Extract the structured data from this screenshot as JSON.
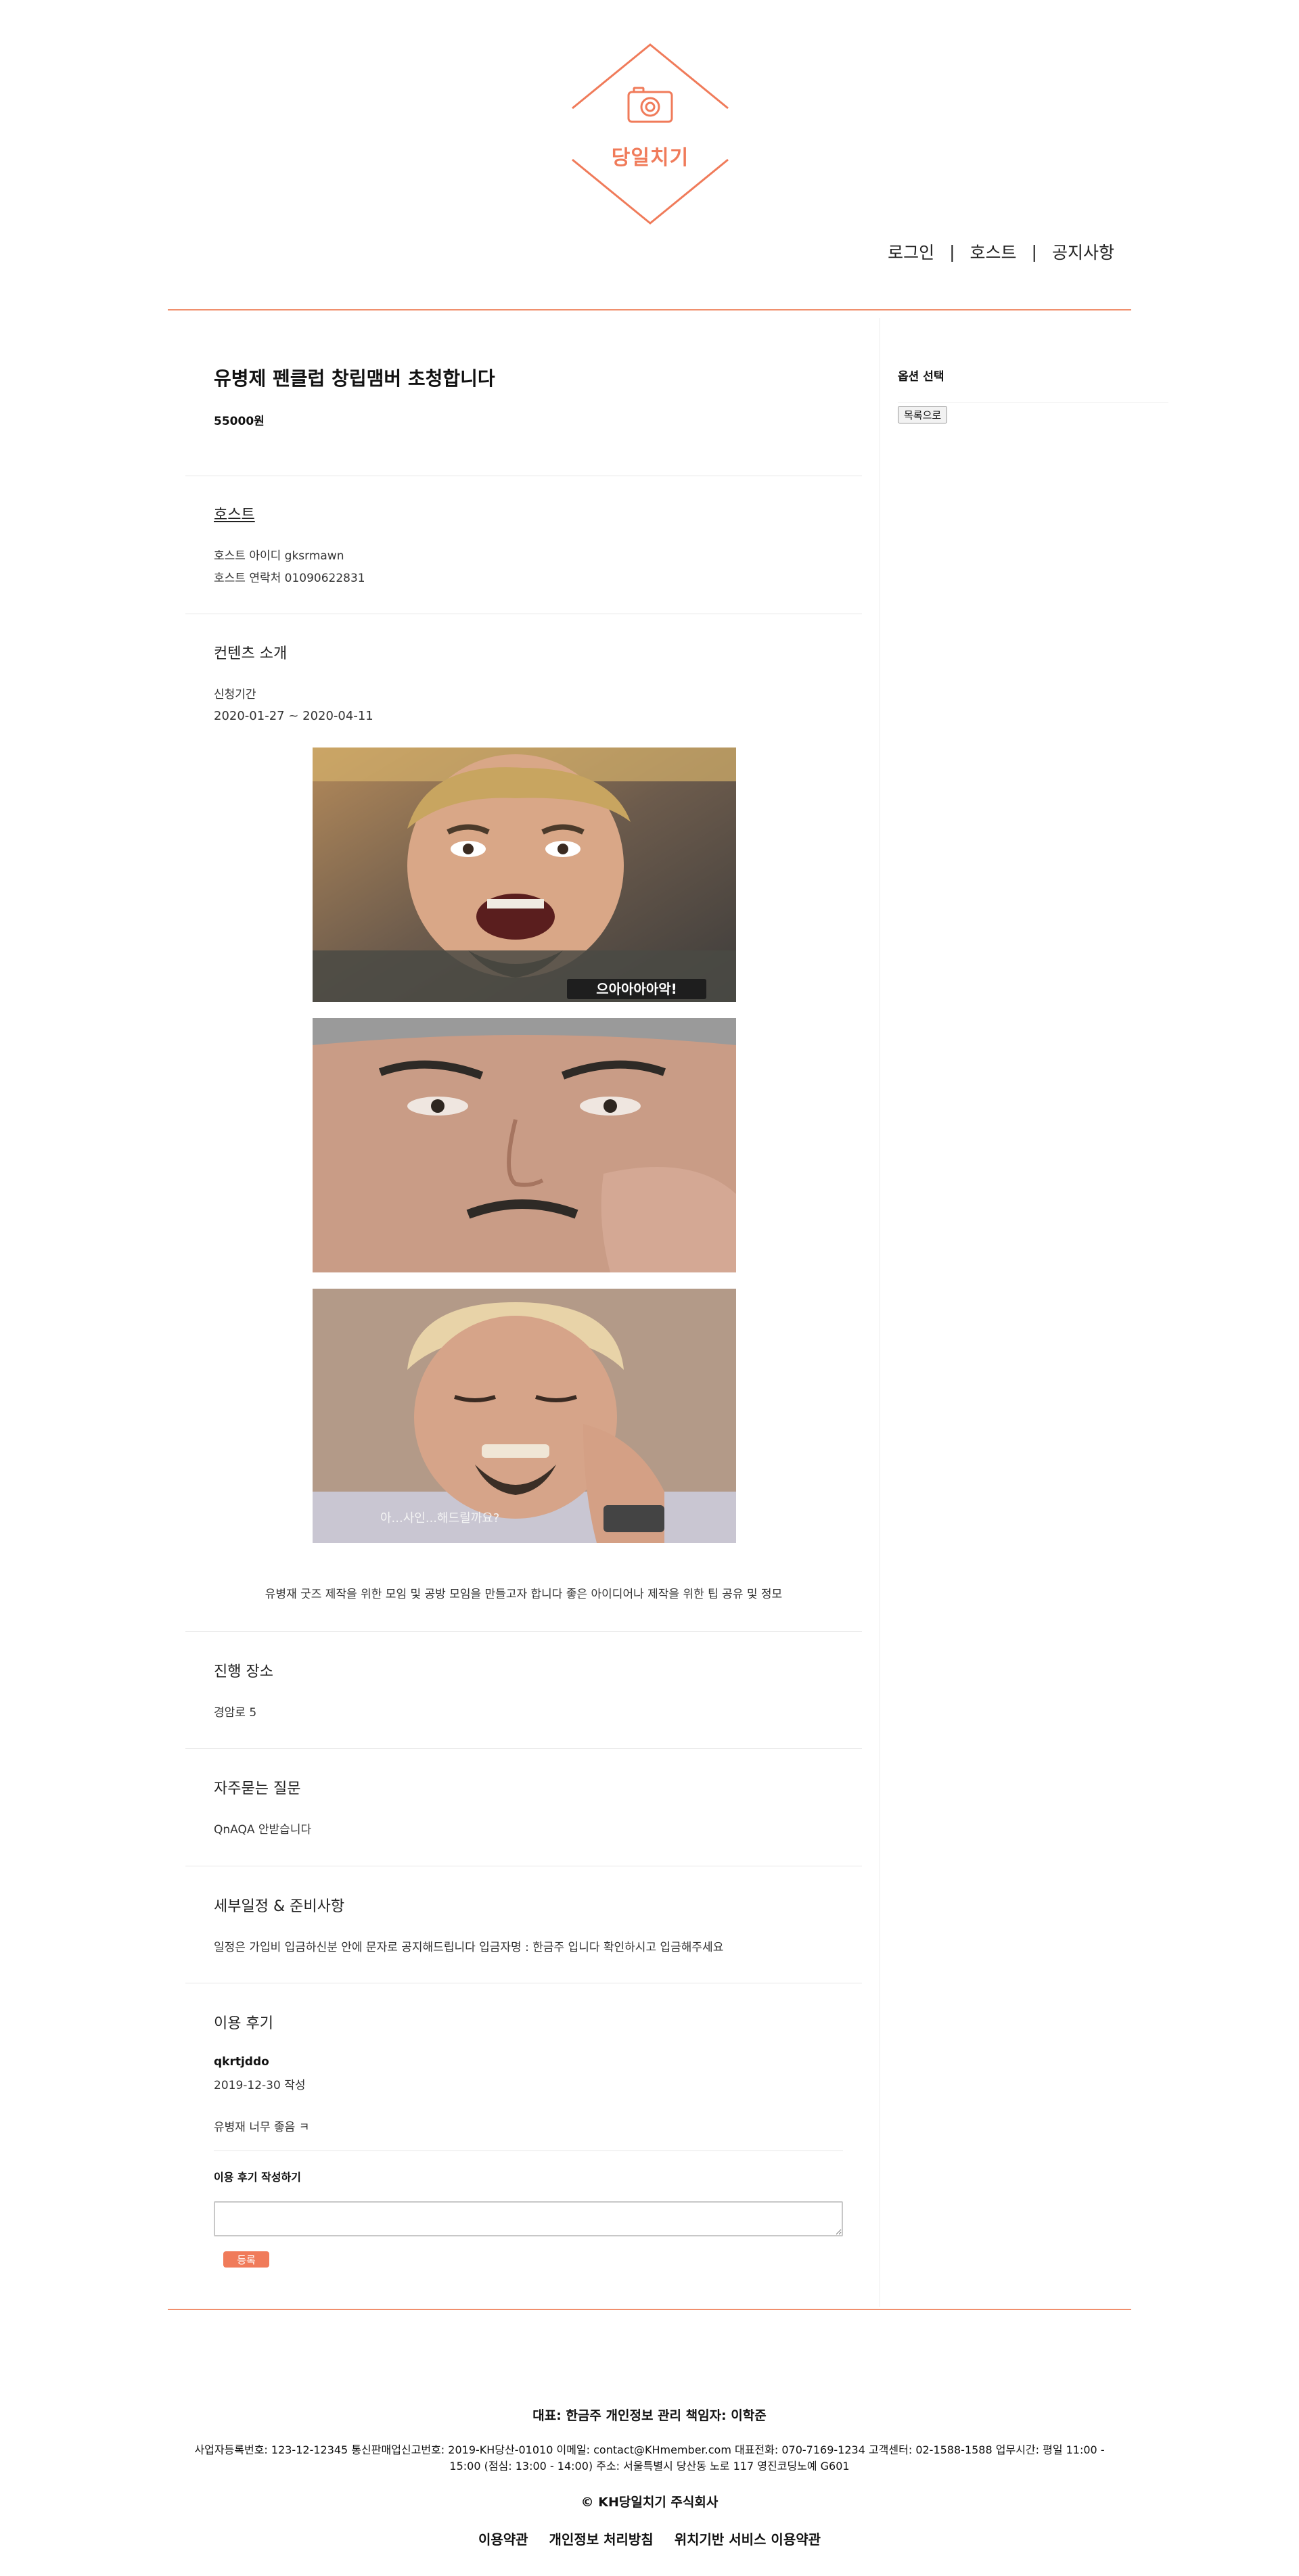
{
  "header": {
    "logo_text": "당일치기",
    "nav": [
      {
        "label": "로그인"
      },
      {
        "label": "호스트"
      },
      {
        "label": "공지사항"
      }
    ],
    "separator": "|",
    "accent_color": "#f07b5a"
  },
  "product": {
    "title": "유병제 펜클럽 창립맴버 초청합니다",
    "price": "55000원"
  },
  "host": {
    "heading": "호스트",
    "id_line": "호스트 아이디 gksrmawn",
    "contact_line": "호스트 연락처 01090622831"
  },
  "content": {
    "heading": "컨텐츠 소개",
    "period_label": "신청기간",
    "period": "2020-01-27 ~ 2020-04-11",
    "image1_caption": "으아아아아악!",
    "image3_caption": "아...사인...해드릴까요?",
    "description": "유병재 굿즈 제작을 위한 모임 및 공방 모임을 만들고자 합니다 좋은 아이디어나 제작을 위한 팁 공유 및 정모"
  },
  "location": {
    "heading": "진행 장소",
    "value": "경암로 5"
  },
  "faq": {
    "heading": "자주묻는 질문",
    "value": "QnAQA 안받습니다"
  },
  "schedule": {
    "heading": "세부일정 & 준비사항",
    "value": "일정은 가입비 입금하신분 안에 문자로 공지해드립니다 입금자명 : 한금주 입니다 확인하시고 입금해주세요"
  },
  "reviews": {
    "heading": "이용 후기",
    "items": [
      {
        "author": "qkrtjddo",
        "date": "2019-12-30 작성",
        "text": "유병재 너무 좋음 ㅋ"
      }
    ],
    "write_label": "이용 후기 작성하기",
    "submit_label": "등록"
  },
  "sidebar": {
    "title": "옵션 선택",
    "back_button": "목록으로"
  },
  "footer": {
    "line1": "대표: 한금주 개인정보 관리 책임자: 이학준",
    "line2": "사업자등록번호: 123-12-12345 통신판매업신고번호: 2019-KH당산-01010 이메일: contact@KHmember.com 대표전화: 070-7169-1234 고객센터: 02-1588-1588 업무시간: 평일 11:00 - 15:00 (점심: 13:00 - 14:00) 주소: 서울특별시 당산동 노로 117 영진코딩노예 G601",
    "line3": "© KH당일치기 주식회사",
    "links": [
      {
        "label": "이용약관"
      },
      {
        "label": "개인정보 처리방침"
      },
      {
        "label": "위치기반 서비스 이용약관"
      }
    ]
  }
}
